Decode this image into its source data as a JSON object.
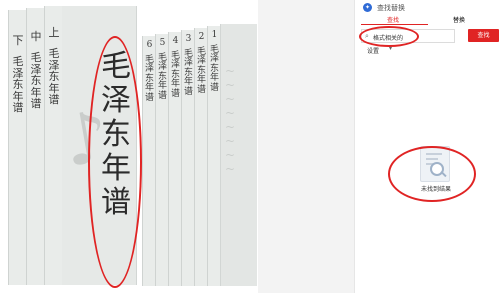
{
  "document": {
    "books_left": [
      {
        "volume": "下",
        "title": "毛泽东年谱"
      },
      {
        "volume": "中",
        "title": "毛泽东年谱"
      },
      {
        "volume": "上",
        "title": "毛泽东年谱"
      }
    ],
    "featured_title": "毛泽东年谱",
    "books_right": [
      {
        "volume": "6",
        "title": "毛泽东年谱"
      },
      {
        "volume": "5",
        "title": "毛泽东年谱"
      },
      {
        "volume": "4",
        "title": "毛泽东年谱"
      },
      {
        "volume": "3",
        "title": "毛泽东年谱"
      },
      {
        "volume": "2",
        "title": "毛泽东年谱"
      },
      {
        "volume": "1",
        "title": "毛泽东年谱"
      }
    ],
    "accent_color": "#e02424"
  },
  "panel": {
    "header": {
      "app_name": "查找替换",
      "app_icon": "app-logo-icon"
    },
    "tabs": [
      {
        "label": "查找",
        "active": true
      },
      {
        "label": "替换",
        "active": false
      }
    ],
    "search": {
      "icon": "search-icon",
      "value": "格式相关的",
      "button_label": "查找"
    },
    "settings": {
      "label": "设置",
      "icon": "chevron-down-icon"
    },
    "empty_state": {
      "icon": "document-search-icon",
      "message": "未找到结果"
    }
  }
}
